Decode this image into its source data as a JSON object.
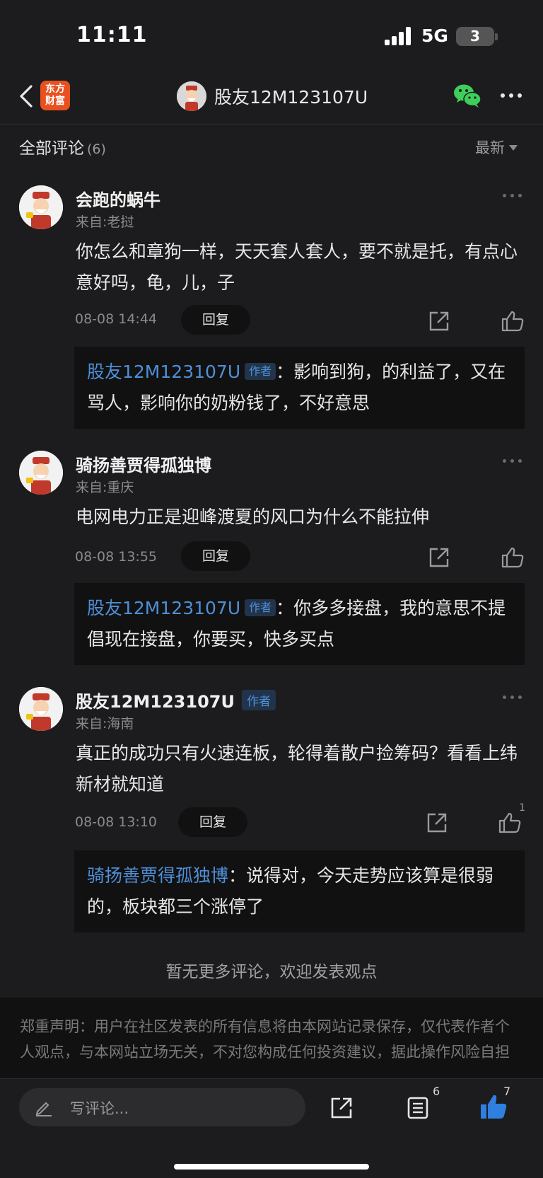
{
  "status_bar": {
    "time": "11:11",
    "network": "5G",
    "battery": "3"
  },
  "nav": {
    "app_logo_line1": "东方",
    "app_logo_line2": "财富",
    "title": "股友12M123107U",
    "icons": [
      "back-icon",
      "wechat-icon",
      "more-icon"
    ]
  },
  "comments_header": {
    "label": "全部评论",
    "count": "(6)",
    "sort": "最新"
  },
  "comments": [
    {
      "name": "会跑的蜗牛",
      "author_tag": "",
      "source": "来自:老挝",
      "text": "你怎么和章狗一样，天天套人套人，要不就是托，有点心意好吗，龟，儿，子",
      "time": "08-08 14:44",
      "reply_label": "回复",
      "likes": "",
      "reply": {
        "author": "股友12M123107U",
        "tag": "作者",
        "sep": "：",
        "text": "影响到狗，的利益了，又在骂人，影响你的奶粉钱了，不好意思"
      }
    },
    {
      "name": "骑扬善贾得孤独博",
      "author_tag": "",
      "source": "来自:重庆",
      "text": "电网电力正是迎峰渡夏的风口为什么不能拉伸",
      "time": "08-08 13:55",
      "reply_label": "回复",
      "likes": "",
      "reply": {
        "author": "股友12M123107U",
        "tag": "作者",
        "sep": "：",
        "text": "你多多接盘，我的意思不提倡现在接盘，你要买，快多买点"
      }
    },
    {
      "name": "股友12M123107U",
      "author_tag": "作者",
      "source": "来自:海南",
      "text": "真正的成功只有火速连板，轮得着散户捡筹码？看看上纬新材就知道",
      "time": "08-08 13:10",
      "reply_label": "回复",
      "likes": "1",
      "reply": {
        "author": "骑扬善贾得孤独博",
        "tag": "",
        "sep": "：",
        "text": "说得对，今天走势应该算是很弱的，板块都三个涨停了"
      }
    }
  ],
  "no_more": "暂无更多评论，欢迎发表观点",
  "disclaimer": "郑重声明：用户在社区发表的所有信息将由本网站记录保存，仅代表作者个人观点，与本网站立场无关，不对您构成任何投资建议，据此操作风险自担",
  "bottom_bar": {
    "placeholder": "写评论...",
    "list_count": "6",
    "like_count": "7"
  },
  "colors": {
    "accent_blue": "#4f8fd6",
    "like_blue": "#2f7fe0",
    "brand_orange": "#e8501f",
    "wechat_green": "#3ecf5a"
  }
}
